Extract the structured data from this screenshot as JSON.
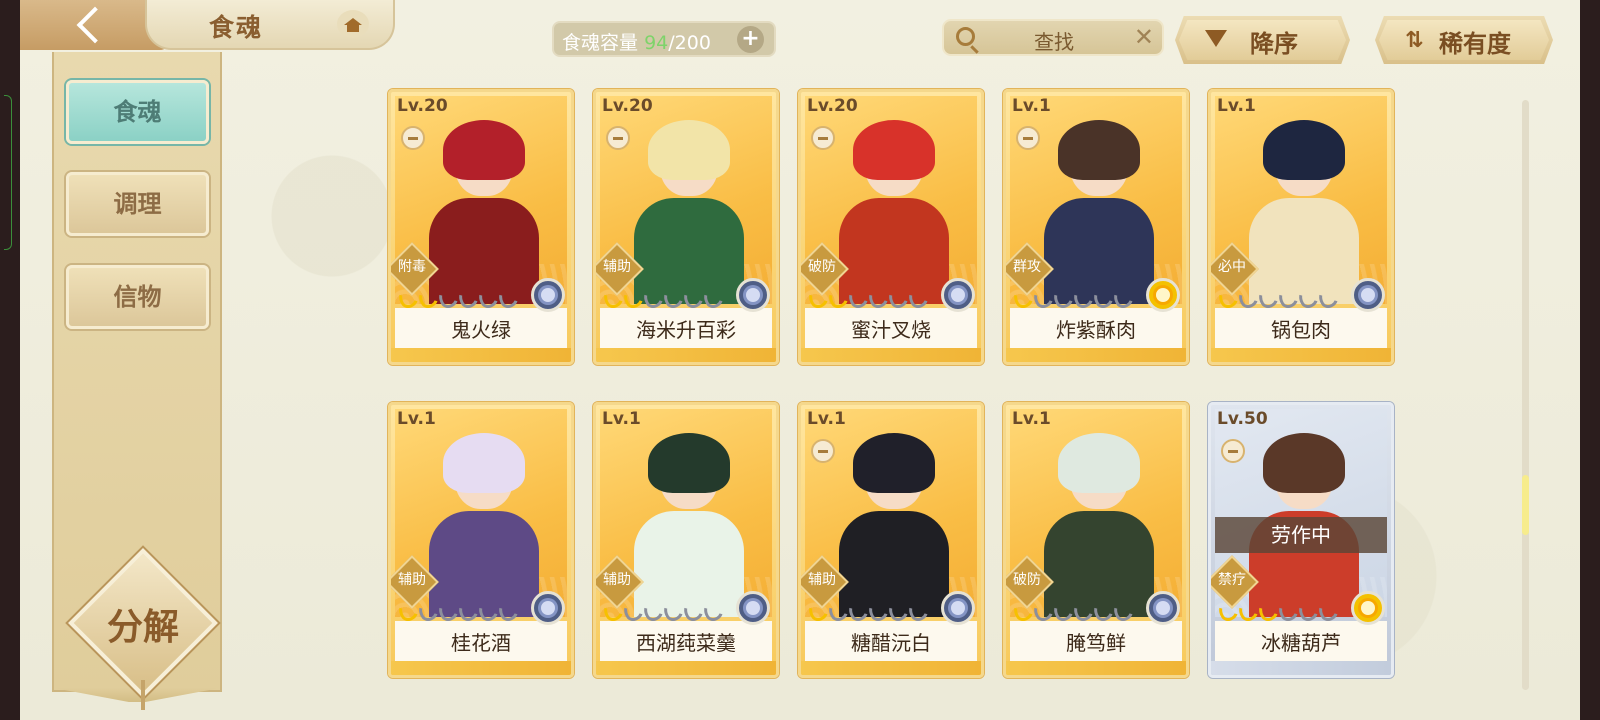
{
  "header": {
    "title": "食魂",
    "capacity_label": "食魂容量",
    "capacity_current": "94",
    "capacity_total": "/200",
    "capacity_add": "+",
    "search_placeholder": "查找",
    "search_clear": "✕",
    "sort_label": "降序",
    "rarity_label": "稀有度",
    "rarity_icon": "⇅"
  },
  "sidebar": {
    "tabs": [
      {
        "label": "食魂",
        "active": true
      },
      {
        "label": "调理",
        "active": false
      },
      {
        "label": "信物",
        "active": false
      }
    ],
    "decompose_label": "分解"
  },
  "cards": [
    {
      "level": "Lv.20",
      "name": "鬼火绿",
      "tag": "附毒",
      "stars": 2,
      "locked": true,
      "hair": "#b3202a",
      "cloth": "#8a1d1d",
      "element": "blue",
      "rarity": "gold"
    },
    {
      "level": "Lv.20",
      "name": "海米升百彩",
      "tag": "辅助",
      "stars": 2,
      "locked": true,
      "hair": "#f2e4a8",
      "cloth": "#2f6b3e",
      "element": "blue",
      "rarity": "gold"
    },
    {
      "level": "Lv.20",
      "name": "蜜汁叉烧",
      "tag": "破防",
      "stars": 2,
      "locked": true,
      "hair": "#d8322a",
      "cloth": "#c2361f",
      "element": "blue",
      "rarity": "gold"
    },
    {
      "level": "Lv.1",
      "name": "炸紫酥肉",
      "tag": "群攻",
      "stars": 1,
      "locked": true,
      "hair": "#4a3328",
      "cloth": "#2e3558",
      "element": "gold",
      "rarity": "gold"
    },
    {
      "level": "Lv.1",
      "name": "锅包肉",
      "tag": "必中",
      "stars": 1,
      "locked": false,
      "hair": "#1e2640",
      "cloth": "#f1e3bd",
      "element": "blue",
      "rarity": "gold"
    },
    {
      "level": "Lv.1",
      "name": "桂花酒",
      "tag": "辅助",
      "stars": 1,
      "locked": false,
      "hair": "#e6dcf2",
      "cloth": "#5e4a86",
      "element": "blue",
      "rarity": "gold"
    },
    {
      "level": "Lv.1",
      "name": "西湖莼菜羹",
      "tag": "辅助",
      "stars": 1,
      "locked": false,
      "hair": "#243a2c",
      "cloth": "#e9f3e8",
      "element": "blue",
      "rarity": "gold"
    },
    {
      "level": "Lv.1",
      "name": "糖醋沅白",
      "tag": "辅助",
      "stars": 1,
      "locked": true,
      "hair": "#20202a",
      "cloth": "#1f1f24",
      "element": "blue",
      "rarity": "gold"
    },
    {
      "level": "Lv.1",
      "name": "腌笃鲜",
      "tag": "破防",
      "stars": 1,
      "locked": false,
      "hair": "#dfe9e0",
      "cloth": "#34442f",
      "element": "blue",
      "rarity": "gold"
    },
    {
      "level": "Lv.50",
      "name": "冰糖葫芦",
      "tag": "禁疗",
      "stars": 3,
      "locked": true,
      "hair": "#5a3828",
      "cloth": "#cc3d2a",
      "element": "gold",
      "rarity": "silver",
      "status": "劳作中"
    }
  ],
  "colors": {
    "accent_teal": "#8bd1c5",
    "gold": "#f7c95a",
    "capacity_current": "#7ed36a"
  }
}
